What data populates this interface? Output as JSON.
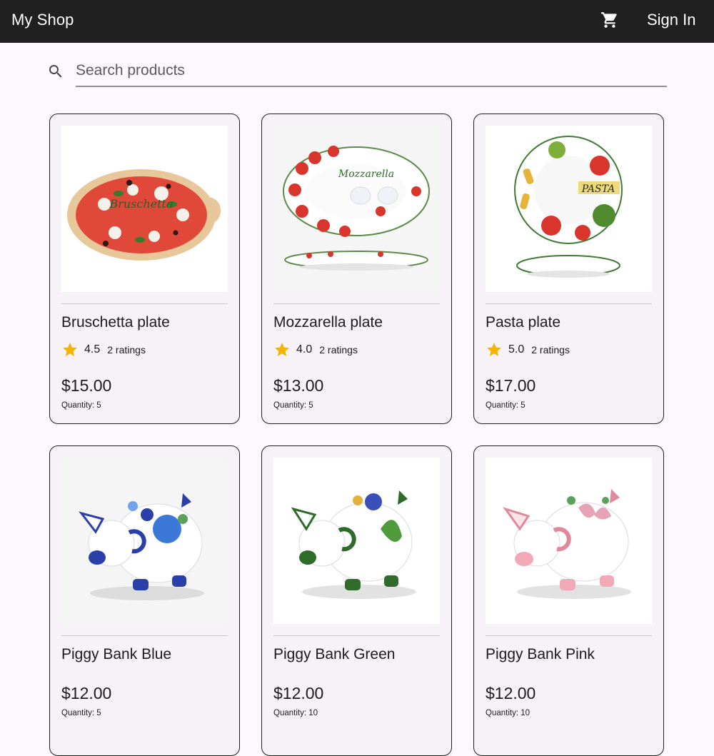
{
  "app": {
    "title": "My Shop",
    "sign_in_label": "Sign In",
    "cart_icon": "shopping-cart-icon"
  },
  "search": {
    "placeholder": "Search products",
    "value": "",
    "icon": "search-icon"
  },
  "colors": {
    "appbar": "#202020",
    "background": "#fdf7fe",
    "card": "#f6f2f8",
    "star": "#f5b400"
  },
  "products": [
    {
      "name": "Bruschetta plate",
      "rating": "4.5",
      "ratings_label": "2 ratings",
      "price": "$15.00",
      "quantity": "Quantity: 5",
      "image_label": "Bruschetta"
    },
    {
      "name": "Mozzarella plate",
      "rating": "4.0",
      "ratings_label": "2 ratings",
      "price": "$13.00",
      "quantity": "Quantity: 5",
      "image_label": "Mozzarella"
    },
    {
      "name": "Pasta plate",
      "rating": "5.0",
      "ratings_label": "2 ratings",
      "price": "$17.00",
      "quantity": "Quantity: 5",
      "image_label": "PASTA"
    },
    {
      "name": "Piggy Bank Blue",
      "price": "$12.00",
      "quantity": "Quantity: 5",
      "accent": "#2a3fa8"
    },
    {
      "name": "Piggy Bank Green",
      "price": "$12.00",
      "quantity": "Quantity: 10",
      "accent": "#2f6b2a"
    },
    {
      "name": "Piggy Bank Pink",
      "price": "$12.00",
      "quantity": "Quantity: 10",
      "accent": "#e0889c"
    }
  ]
}
